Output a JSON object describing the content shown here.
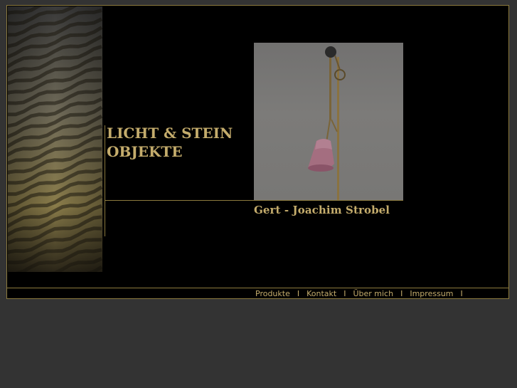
{
  "brand": {
    "line1": "LICHT & STEIN",
    "line2": "OBJEKTE"
  },
  "author": "Gert - Joachim Strobel",
  "nav": {
    "items": [
      {
        "label": "Produkte"
      },
      {
        "label": "Kontakt"
      },
      {
        "label": "Über mich"
      },
      {
        "label": "Impressum"
      }
    ],
    "separator": "I"
  },
  "colors": {
    "page_background": "#333333",
    "frame_background": "#000000",
    "accent": "#c4ac6c",
    "border": "#8c7a3e"
  }
}
